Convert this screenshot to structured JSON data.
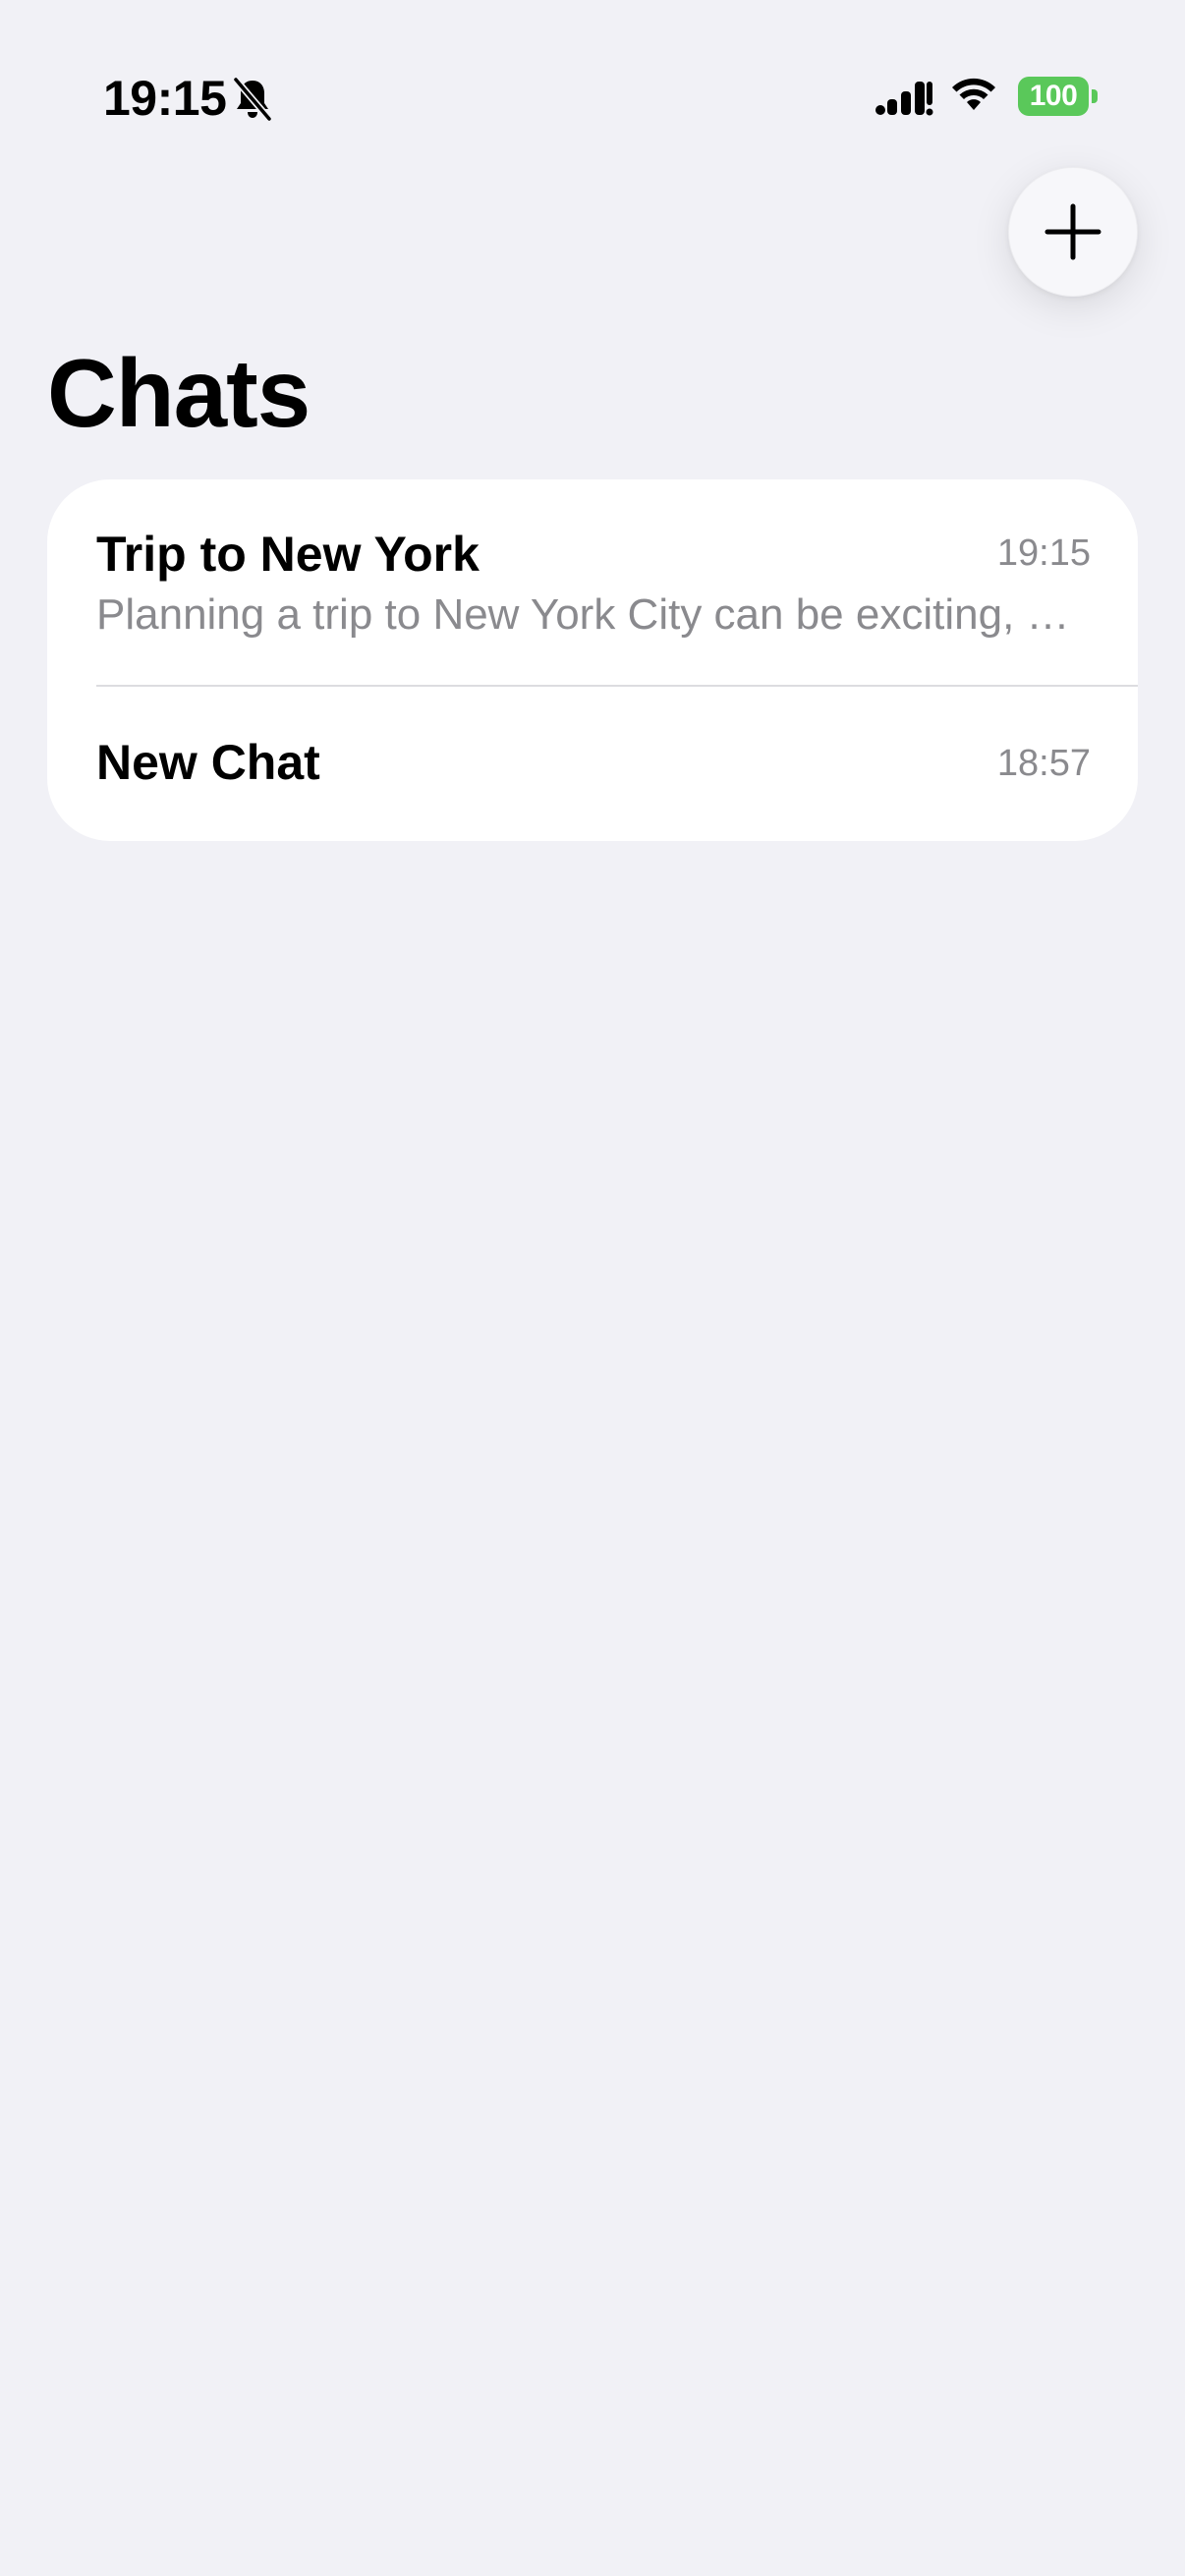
{
  "status_bar": {
    "time": "19:15",
    "battery_level": "100",
    "battery_color": "#5ac85a",
    "icons": [
      "bell-slash-icon",
      "signal-icon",
      "wifi-icon",
      "battery-icon"
    ]
  },
  "header": {
    "title": "Chats",
    "compose_icon": "plus-icon"
  },
  "chats": [
    {
      "title": "Trip to New York",
      "time": "19:15",
      "preview": "Planning a trip to New York City can be exciting, but it requires careful planning to make the most of your visit."
    },
    {
      "title": "New Chat",
      "time": "18:57",
      "preview": ""
    }
  ],
  "colors": {
    "background": "#f1f1f6",
    "card": "#ffffff",
    "secondary_text": "#8a8a8e"
  }
}
